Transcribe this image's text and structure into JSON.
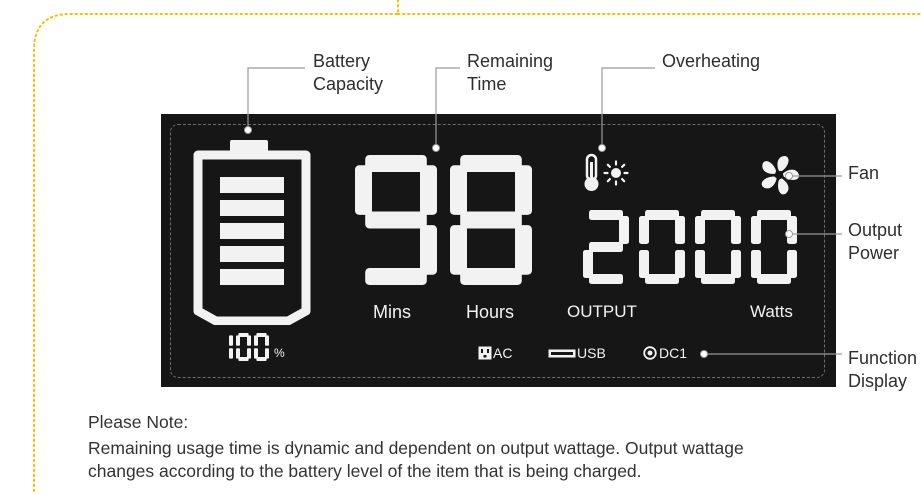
{
  "callouts": {
    "battery_capacity": "Battery\nCapacity",
    "remaining_time": "Remaining\nTime",
    "overheating": "Overheating",
    "fan": "Fan",
    "output_power": "Output\nPower",
    "function_display": "Function\nDisplay"
  },
  "display": {
    "battery_percent": "100",
    "percent_sign": "%",
    "time_digits": "98",
    "mins_label": "Mins",
    "hours_label": "Hours",
    "output_digits": "2000",
    "output_label": "OUTPUT",
    "watts_label": "Watts",
    "ac_label": "AC",
    "usb_label": "USB",
    "dc_label": "DC1",
    "battery_bars": 5
  },
  "note": {
    "heading": "Please Note:",
    "line1": "Remaining usage time is dynamic and dependent on output wattage. Output wattage",
    "line2": "changes according to the battery level of the item that is being charged."
  },
  "colors": {
    "panel": "#161616",
    "segment": "#f2f2f2",
    "frame_dots": "#f2c200",
    "leader": "#9a9a9a"
  }
}
